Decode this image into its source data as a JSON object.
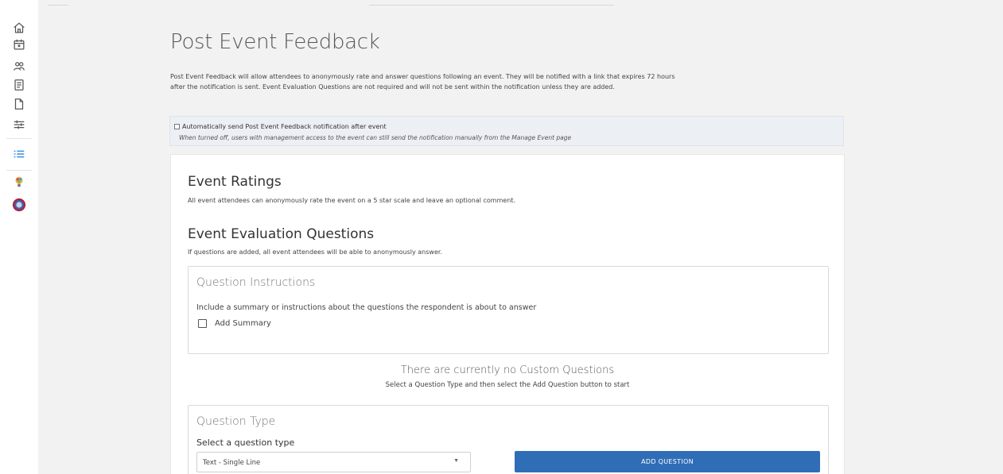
{
  "sidebar": {
    "items": [
      {
        "icon": "home-icon"
      },
      {
        "icon": "calendar-icon"
      },
      {
        "icon": "people-icon"
      },
      {
        "icon": "document-icon"
      },
      {
        "icon": "file-icon"
      },
      {
        "icon": "sliders-icon"
      },
      {
        "icon": "list-icon",
        "active": true
      }
    ],
    "accent": "#3b8ee0"
  },
  "page": {
    "title": "Post Event Feedback",
    "intro": "Post Event Feedback will allow attendees to anonymously rate and answer questions following an event. They will be notified with a link that expires 72 hours after the notification is sent. Event Evaluation Questions are not required and will not be sent within the notification unless they are added."
  },
  "auto_send": {
    "label": "Automatically send Post Event Feedback notification after event",
    "help": "When turned off, users with management access to the event can still send the notification manually from the Manage Event page",
    "checked": false
  },
  "ratings": {
    "title": "Event Ratings",
    "description": "All event attendees can anonymously rate the event on a 5 star scale and leave an optional comment."
  },
  "evaluation": {
    "title": "Event Evaluation Questions",
    "description": "If questions are added, all event attendees will be able to anonymously answer."
  },
  "instructions": {
    "title": "Question Instructions",
    "text": "Include a summary or instructions about the questions the respondent is about to answer",
    "add_summary_label": "Add Summary",
    "checked": false
  },
  "empty_state": {
    "title": "There are currently no Custom Questions",
    "subtitle": "Select a Question Type and then select the Add Question button to start"
  },
  "question_type": {
    "title": "Question Type",
    "label": "Select a question type",
    "selected": "Text - Single Line",
    "add_button": "ADD QUESTION",
    "button_color": "#2f6db7"
  }
}
